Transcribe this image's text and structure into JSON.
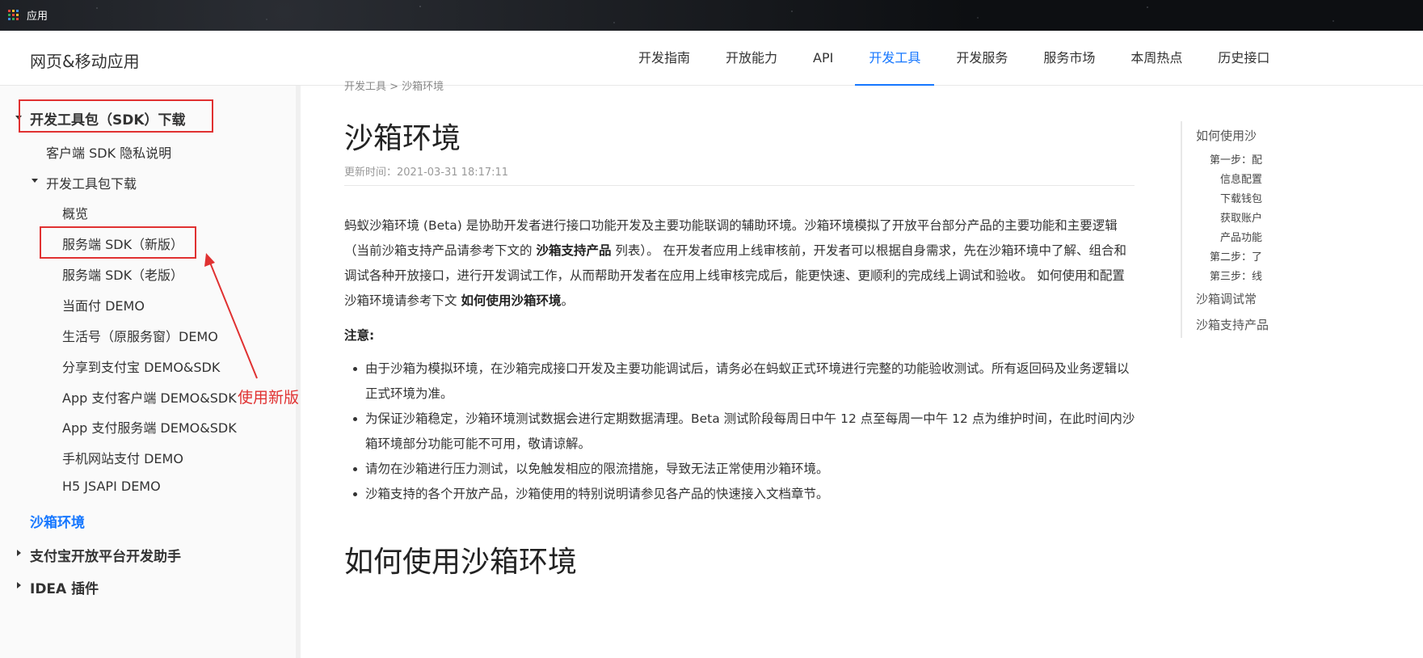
{
  "topbar": {
    "apps_label": "应用"
  },
  "header": {
    "brand": "网页&移动应用",
    "nav": [
      "开发指南",
      "开放能力",
      "API",
      "开发工具",
      "开发服务",
      "服务市场",
      "本周热点",
      "历史接口"
    ],
    "active_nav": "开发工具",
    "accent_color": "#1677ff"
  },
  "sidebar": {
    "sdk_download": "开发工具包（SDK）下载",
    "client_sdk_privacy": "客户端 SDK 隐私说明",
    "dev_toolkit_download": "开发工具包下载",
    "overview": "概览",
    "server_sdk_new": "服务端 SDK（新版）",
    "server_sdk_old": "服务端 SDK（老版）",
    "face_pay_demo": "当面付 DEMO",
    "life_account_demo": "生活号（原服务窗）DEMO",
    "share_demo": "分享到支付宝 DEMO&SDK",
    "app_client_demo": "App 支付客户端 DEMO&SDK",
    "app_server_demo": "App 支付服务端 DEMO&SDK",
    "mobile_web_demo": "手机网站支付 DEMO",
    "h5_jsapi_demo": "H5 JSAPI DEMO",
    "sandbox": "沙箱环境",
    "assistant": "支付宝开放平台开发助手",
    "idea_plugin": "IDEA 插件"
  },
  "annotation": {
    "label": "使用新版",
    "color": "#e03131"
  },
  "main": {
    "breadcrumb": "开发工具 > 沙箱环境",
    "title": "沙箱环境",
    "update_time": "更新时间：2021-03-31 18:17:11",
    "intro_1": "蚂蚁沙箱环境 (Beta) 是协助开发者进行接口功能开发及主要功能联调的辅助环境。沙箱环境模拟了开放平台部分产品的主要功能和主要逻辑（当前沙箱支持产品请参考下文的 ",
    "intro_bold_1": "沙箱支持产品",
    "intro_2": " 列表）。 在开发者应用上线审核前，开发者可以根据自身需求，先在沙箱环境中了解、组合和调试各种开放接口，进行开发调试工作，从而帮助开发者在应用上线审核完成后，能更快速、更顺利的完成线上调试和验收。 如何使用和配置沙箱环境请参考下文 ",
    "intro_bold_2": "如何使用沙箱环境",
    "intro_3": "。",
    "note_label": "注意:",
    "bullets": [
      "由于沙箱为模拟环境，在沙箱完成接口开发及主要功能调试后，请务必在蚂蚁正式环境进行完整的功能验收测试。所有返回码及业务逻辑以正式环境为准。",
      "为保证沙箱稳定，沙箱环境测试数据会进行定期数据清理。Beta 测试阶段每周日中午 12 点至每周一中午 12 点为维护时间，在此时间内沙箱环境部分功能可能不可用，敬请谅解。",
      "请勿在沙箱进行压力测试，以免触发相应的限流措施，导致无法正常使用沙箱环境。",
      "沙箱支持的各个开放产品，沙箱使用的特别说明请参见各产品的快速接入文档章节。"
    ],
    "section_title": "如何使用沙箱环境"
  },
  "toc": {
    "how_to_use": "如何使用沙",
    "step1": "第一步：配",
    "info_config": "信息配置",
    "download_wallet": "下载钱包",
    "get_account": "获取账户",
    "product_feature": "产品功能",
    "step2": "第二步：了",
    "step3": "第三步：线",
    "faq": "沙箱调试常",
    "supported_products": "沙箱支持产品"
  }
}
